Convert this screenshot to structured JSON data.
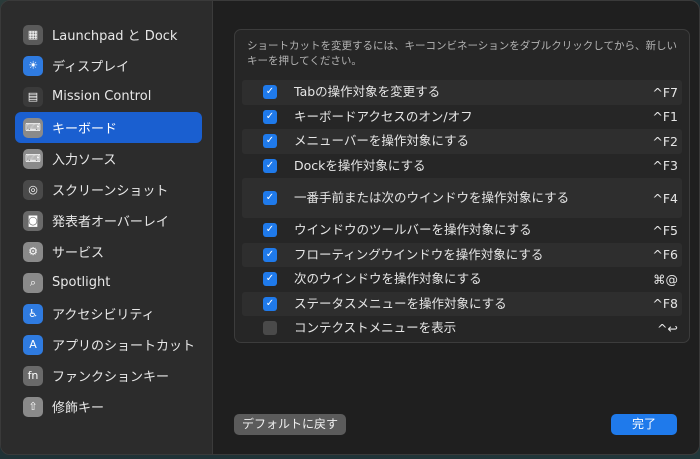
{
  "sidebar": {
    "items": [
      {
        "label": "Launchpad と Dock",
        "icon": "launchpad-icon",
        "glyph": "▦",
        "color": "#5a5a5a",
        "selected": false
      },
      {
        "label": "ディスプレイ",
        "icon": "display-icon",
        "glyph": "☀",
        "color": "#2f7be0",
        "selected": false
      },
      {
        "label": "Mission Control",
        "icon": "mission-control-icon",
        "glyph": "▤",
        "color": "#3a3a3a",
        "selected": false
      },
      {
        "label": "キーボード",
        "icon": "keyboard-icon",
        "glyph": "⌨",
        "color": "#8a8a8a",
        "selected": true
      },
      {
        "label": "入力ソース",
        "icon": "input-source-icon",
        "glyph": "⌨",
        "color": "#8a8a8a",
        "selected": false
      },
      {
        "label": "スクリーンショット",
        "icon": "screenshot-icon",
        "glyph": "◎",
        "color": "#4a4a4a",
        "selected": false
      },
      {
        "label": "発表者オーバーレイ",
        "icon": "presenter-overlay-icon",
        "glyph": "◙",
        "color": "#6a6a6a",
        "selected": false
      },
      {
        "label": "サービス",
        "icon": "services-icon",
        "glyph": "⚙",
        "color": "#8a8a8a",
        "selected": false
      },
      {
        "label": "Spotlight",
        "icon": "spotlight-icon",
        "glyph": "⌕",
        "color": "#8a8a8a",
        "selected": false
      },
      {
        "label": "アクセシビリティ",
        "icon": "accessibility-icon",
        "glyph": "♿",
        "color": "#2f7be0",
        "selected": false
      },
      {
        "label": "アプリのショートカット",
        "icon": "app-shortcuts-icon",
        "glyph": "A",
        "color": "#2f7be0",
        "selected": false
      },
      {
        "label": "ファンクションキー",
        "icon": "function-keys-icon",
        "glyph": "fn",
        "color": "#6a6a6a",
        "selected": false
      },
      {
        "label": "修飾キー",
        "icon": "modifier-keys-icon",
        "glyph": "⇧",
        "color": "#8a8a8a",
        "selected": false
      }
    ]
  },
  "panel": {
    "description": "ショートカットを変更するには、キーコンビネーションをダブルクリックしてから、新しいキーを押してください。",
    "shortcuts": [
      {
        "label": "Tabの操作対象を変更する",
        "key": "^F7",
        "checked": true
      },
      {
        "label": "キーボードアクセスのオン/オフ",
        "key": "^F1",
        "checked": true
      },
      {
        "label": "メニューバーを操作対象にする",
        "key": "^F2",
        "checked": true
      },
      {
        "label": "Dockを操作対象にする",
        "key": "^F3",
        "checked": true
      },
      {
        "label": "一番手前または次のウインドウを操作対象にする",
        "key": "^F4",
        "checked": true
      },
      {
        "label": "ウインドウのツールバーを操作対象にする",
        "key": "^F5",
        "checked": true
      },
      {
        "label": "フローティングウインドウを操作対象にする",
        "key": "^F6",
        "checked": true
      },
      {
        "label": "次のウインドウを操作対象にする",
        "key": "⌘@",
        "checked": true
      },
      {
        "label": "ステータスメニューを操作対象にする",
        "key": "^F8",
        "checked": true
      },
      {
        "label": "コンテクストメニューを表示",
        "key": "^↩",
        "checked": false
      }
    ]
  },
  "buttons": {
    "default_label": "デフォルトに戻す",
    "done_label": "完了"
  },
  "colors": {
    "accent": "#1f7aeb",
    "selection": "#1a5fd0"
  }
}
